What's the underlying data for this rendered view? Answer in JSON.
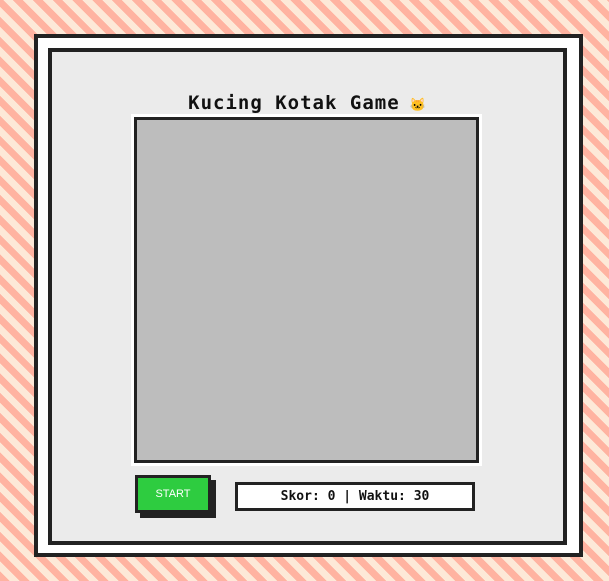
{
  "game": {
    "title": "Kucing Kotak Game",
    "title_emoji": "🐱"
  },
  "controls": {
    "start_label": "START"
  },
  "status": {
    "text": "Skor: 0 | Waktu: 30",
    "score": 0,
    "time_remaining": 30
  },
  "colors": {
    "stripe_primary": "#ffb3a1",
    "stripe_secondary": "#fde9d8",
    "panel_background": "#ebebeb",
    "board_background": "#bdbdbd",
    "start_button": "#2ecc40",
    "border": "#222222"
  }
}
